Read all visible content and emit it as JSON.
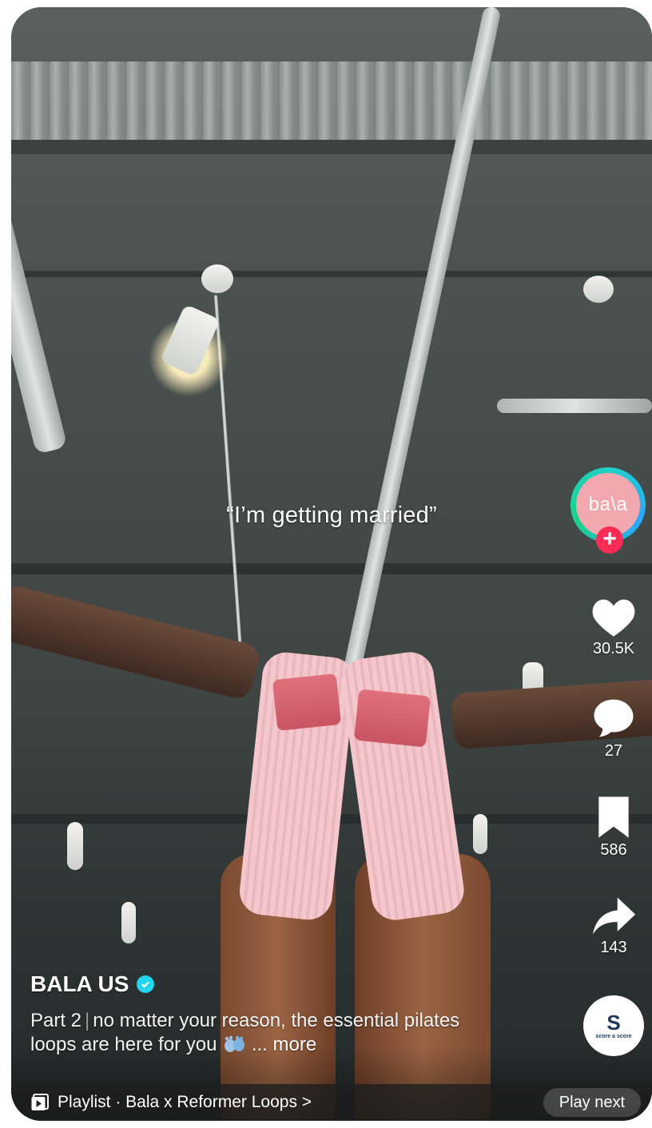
{
  "video": {
    "overlay_text": "“I’m getting married”"
  },
  "creator": {
    "avatar_text": "ba\\a",
    "name": "BALA US",
    "verified": true
  },
  "actions": {
    "likes": "30.5K",
    "comments": "27",
    "saves": "586",
    "shares": "143"
  },
  "sound": {
    "label_big": "S",
    "label_small": "score a score"
  },
  "description": {
    "part": "Part 2",
    "text": "no matter your reason, the essential pilates loops are here for you",
    "more": "... more"
  },
  "playlist": {
    "label": "Playlist · Bala x Reformer Loops >",
    "play_next": "Play next"
  },
  "icons": [
    "plus-icon",
    "heart-icon",
    "comment-icon",
    "bookmark-icon",
    "share-icon",
    "playlist-icon",
    "verified-icon",
    "feet-emoji-icon"
  ],
  "colors": {
    "follow_plus": "#fe2c55",
    "verified": "#20d5ec",
    "avatar_bg": "#f2a8ae"
  }
}
